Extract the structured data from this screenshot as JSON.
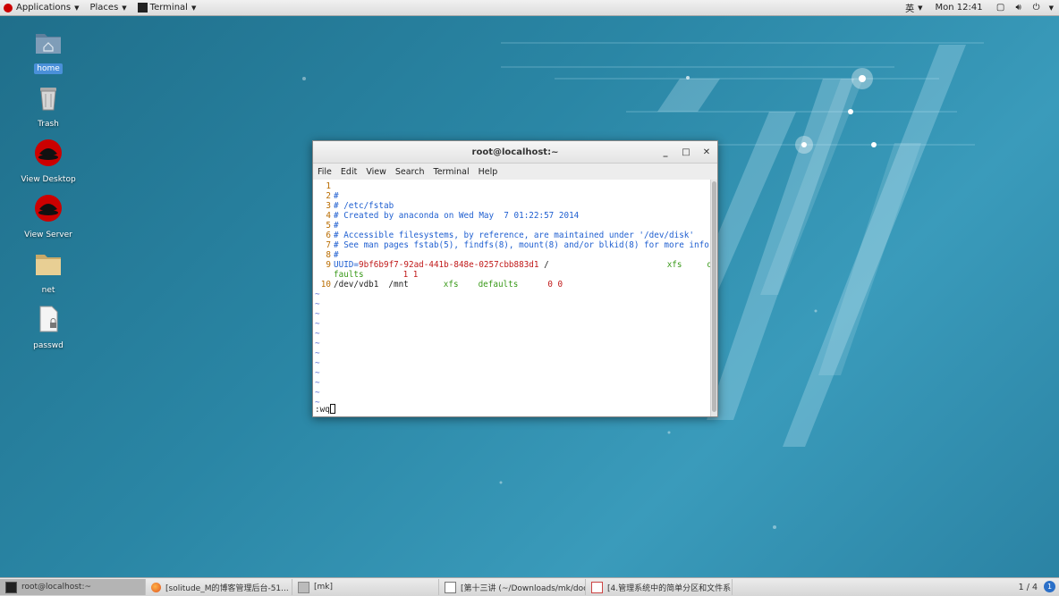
{
  "top_panel": {
    "applications": "Applications",
    "places": "Places",
    "terminal": "Terminal",
    "input_method": "英",
    "clock": "Mon 12:41"
  },
  "desktop_icons": [
    {
      "label": "home",
      "icon": "folder-home-icon"
    },
    {
      "label": "Trash",
      "icon": "trash-icon"
    },
    {
      "label": "View Desktop",
      "icon": "redhat-icon"
    },
    {
      "label": "View Server",
      "icon": "redhat-icon"
    },
    {
      "label": "net",
      "icon": "folder-icon"
    },
    {
      "label": "passwd",
      "icon": "locked-file-icon"
    }
  ],
  "terminal": {
    "title": "root@localhost:~",
    "menu": [
      "File",
      "Edit",
      "View",
      "Search",
      "Terminal",
      "Help"
    ],
    "lines": [
      {
        "n": "1",
        "text": ""
      },
      {
        "n": "2",
        "text": "#"
      },
      {
        "n": "3",
        "text": "# /etc/fstab"
      },
      {
        "n": "4",
        "text": "# Created by anaconda on Wed May  7 01:22:57 2014"
      },
      {
        "n": "5",
        "text": "#"
      },
      {
        "n": "6",
        "text": "# Accessible filesystems, by reference, are maintained under '/dev/disk'"
      },
      {
        "n": "7",
        "text": "# See man pages fstab(5), findfs(8), mount(8) and/or blkid(8) for more info"
      },
      {
        "n": "8",
        "text": "#"
      }
    ],
    "line9": {
      "n": "9",
      "uuid_key": "UUID=",
      "uuid_val": "9bf6b9f7-92ad-441b-848e-0257cbb883d1",
      "mount": " /",
      "fstype": "xfs",
      "opts_a": "de",
      "opts_b": "faults",
      "nums": "1 1"
    },
    "line10": {
      "n": "10",
      "device": "/dev/vdb1",
      "mount": "/mnt",
      "fstype": "xfs",
      "opts": "defaults",
      "nums": "0 0"
    },
    "tilde": "~",
    "command": ":wq"
  },
  "taskbar": {
    "tasks": [
      {
        "label": "root@localhost:~",
        "icon": "terminal-icon"
      },
      {
        "label": "[solitude_M的博客管理后台-51...",
        "icon": "firefox-icon"
      },
      {
        "label": "[mk]",
        "icon": "file-manager-icon"
      },
      {
        "label": "[第十三讲 (~/Downloads/mk/doc/...",
        "icon": "text-editor-icon"
      },
      {
        "label": "[4.管理系统中的简单分区和文件系...",
        "icon": "document-viewer-icon"
      }
    ],
    "workspace": "1 / 4",
    "notification": "1"
  },
  "colors": {
    "desktop_bg": "#2a86a5",
    "selected_label": "#4a90d9",
    "vim_line_number": "#b96c00",
    "vim_comment": "#1f5fd0",
    "vim_string_red": "#c01818",
    "vim_keyword_green": "#3a9a1a"
  }
}
